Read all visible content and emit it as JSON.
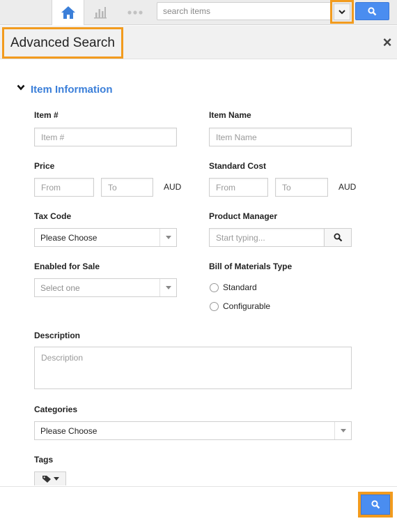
{
  "toolbar": {
    "search_placeholder": "search items",
    "icons": {
      "home": "home-icon",
      "reports": "bar-chart-icon",
      "more": "more-dots-icon",
      "dropdown": "chevron-down-icon",
      "search": "search-icon"
    },
    "colors": {
      "accent": "#4a8df0",
      "highlight": "#f29b1e"
    }
  },
  "dialog": {
    "title": "Advanced Search",
    "close_label": "×"
  },
  "section": {
    "title": "Item Information"
  },
  "fields": {
    "item_number": {
      "label": "Item #",
      "placeholder": "Item #"
    },
    "item_name": {
      "label": "Item Name",
      "placeholder": "Item Name"
    },
    "price": {
      "label": "Price",
      "from_placeholder": "From",
      "to_placeholder": "To",
      "unit": "AUD"
    },
    "standard_cost": {
      "label": "Standard Cost",
      "from_placeholder": "From",
      "to_placeholder": "To",
      "unit": "AUD"
    },
    "tax_code": {
      "label": "Tax Code",
      "value": "Please Choose"
    },
    "product_manager": {
      "label": "Product Manager",
      "placeholder": "Start typing..."
    },
    "enabled_for_sale": {
      "label": "Enabled for Sale",
      "value": "Select one"
    },
    "bom_type": {
      "label": "Bill of Materials Type",
      "options": [
        "Standard",
        "Configurable"
      ]
    },
    "description": {
      "label": "Description",
      "placeholder": "Description"
    },
    "categories": {
      "label": "Categories",
      "value": "Please Choose"
    },
    "tags": {
      "label": "Tags"
    }
  }
}
